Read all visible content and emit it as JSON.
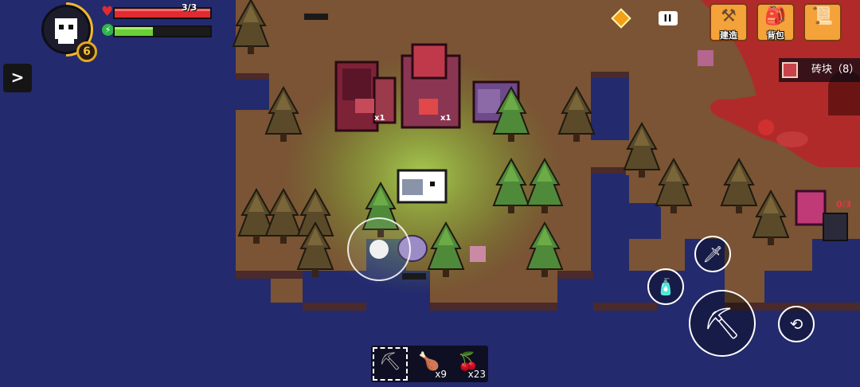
{
  "hud": {
    "health_text": "3/3",
    "health_fraction": 1.0,
    "energy_fraction": 0.4,
    "level": "6",
    "expand_label": ">",
    "pause_label": "II"
  },
  "top_buttons": {
    "build_label": "建造",
    "bag_label": "背包"
  },
  "resource_tip": {
    "text": "砖块（8）"
  },
  "world_labels": {
    "furnace_count": "x1",
    "anvil_count": "x1",
    "enemy_label": "0/3"
  },
  "hotbar": {
    "slots": [
      {
        "item": "pickaxe-icon",
        "count": ""
      },
      {
        "item": "meat-icon",
        "count": "x9"
      },
      {
        "item": "berry-icon",
        "count": "x23"
      }
    ]
  },
  "colors": {
    "water": "#242a6e",
    "ground": "#7a5434",
    "accent": "#f4a23a",
    "health": "#e02b32",
    "energy": "#6bcf3a"
  }
}
